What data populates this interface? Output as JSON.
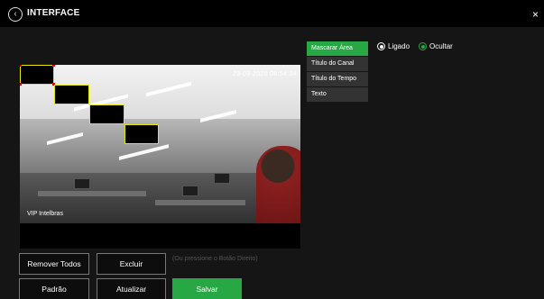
{
  "header": {
    "title": "INTERFACE",
    "back_icon": "‹",
    "close_icon": "×"
  },
  "video": {
    "timestamp": "23-09-2020 08:54:34",
    "channel_title": "VIP Intelbras"
  },
  "menu": {
    "items": [
      {
        "label": "Mascarar Área",
        "active": true
      },
      {
        "label": "Título do Canal",
        "active": false
      },
      {
        "label": "Título do Tempo",
        "active": false
      },
      {
        "label": "Texto",
        "active": false
      }
    ]
  },
  "options": {
    "on_label": "Ligado",
    "hide_label": "Ocultar",
    "selected": "Ocultar"
  },
  "buttons": {
    "remove_all": "Remover Todos",
    "delete": "Excluir",
    "default": "Padrão",
    "refresh": "Atualizar",
    "save": "Salvar"
  },
  "hint": "(Ou pressione o Botão Direito)",
  "colors": {
    "accent": "#27a844",
    "mask_border": "#e6e600",
    "mask_corner": "#e60000"
  }
}
